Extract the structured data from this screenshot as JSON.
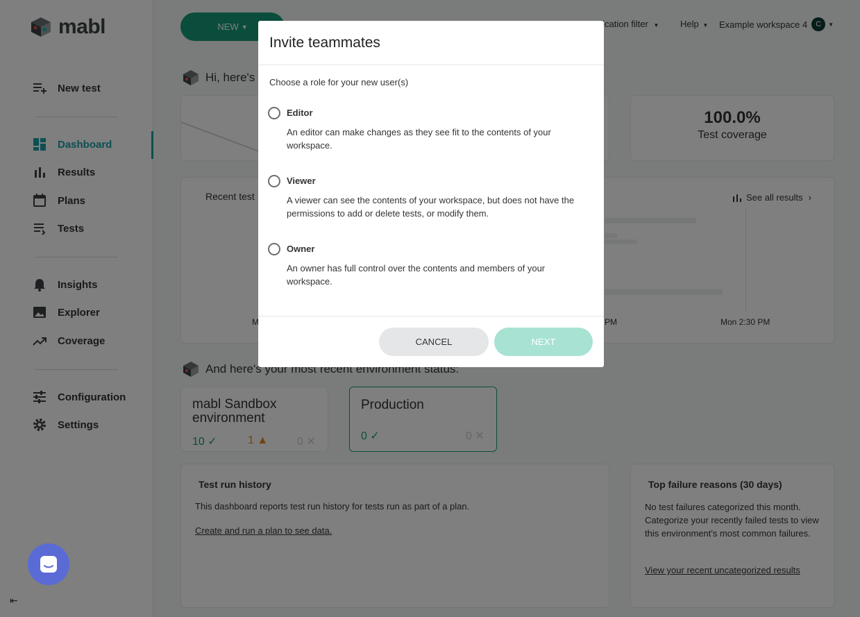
{
  "app": {
    "logo_text": "mabl"
  },
  "sidebar": {
    "items": [
      {
        "label": "New test",
        "icon": "new-test-icon"
      },
      {
        "label": "Dashboard",
        "icon": "dashboard-icon",
        "active": true
      },
      {
        "label": "Results",
        "icon": "bar-chart-icon"
      },
      {
        "label": "Plans",
        "icon": "calendar-icon"
      },
      {
        "label": "Tests",
        "icon": "list-icon"
      },
      {
        "label": "Insights",
        "icon": "bell-icon"
      },
      {
        "label": "Explorer",
        "icon": "image-icon"
      },
      {
        "label": "Coverage",
        "icon": "trending-icon"
      },
      {
        "label": "Configuration",
        "icon": "sliders-icon"
      },
      {
        "label": "Settings",
        "icon": "gear-icon"
      }
    ],
    "collapse_glyph": "⇤"
  },
  "header": {
    "new_label": "NEW",
    "app_filter": "plication filter",
    "help": "Help",
    "workspace": "Example workspace 4",
    "avatar_letter": "C"
  },
  "main": {
    "greeting": "Hi, here's a",
    "coverage_value": "100.0%",
    "coverage_label": "Test coverage",
    "recent_tests_label": "Recent test",
    "see_all_results": "See all results",
    "time_labels": [
      "M",
      "PM",
      "Mon 2:30 PM"
    ],
    "env_greeting": "And here's your most recent environment status:",
    "environments": [
      {
        "name": "mabl Sandbox environment",
        "passed": "10",
        "warnings": "1",
        "failed": "0"
      },
      {
        "name": "Production",
        "passed": "0",
        "failed": "0"
      }
    ],
    "history": {
      "title": "Test run history",
      "text": "This dashboard reports test run history for tests run as part of a plan.",
      "link": "Create and run a plan to see data."
    },
    "failures": {
      "title": "Top failure reasons (30 days)",
      "text": "No test failures categorized this month. Categorize your recently failed tests to view this environment's most common failures.",
      "link": "View your recent uncategorized results"
    }
  },
  "modal": {
    "title": "Invite teammates",
    "subtitle": "Choose a role for your new user(s)",
    "roles": [
      {
        "label": "Editor",
        "desc": "An editor can make changes as they see fit to the contents of your workspace."
      },
      {
        "label": "Viewer",
        "desc": "A viewer can see the contents of your workspace, but does not have the permissions to add or delete tests, or modify them."
      },
      {
        "label": "Owner",
        "desc": "An owner has full control over the contents and members of your workspace."
      }
    ],
    "cancel_label": "CANCEL",
    "next_label": "NEXT"
  },
  "colors": {
    "accent": "#1a9fa4",
    "primary": "#179a78",
    "next_disabled": "#a8e2d3"
  }
}
